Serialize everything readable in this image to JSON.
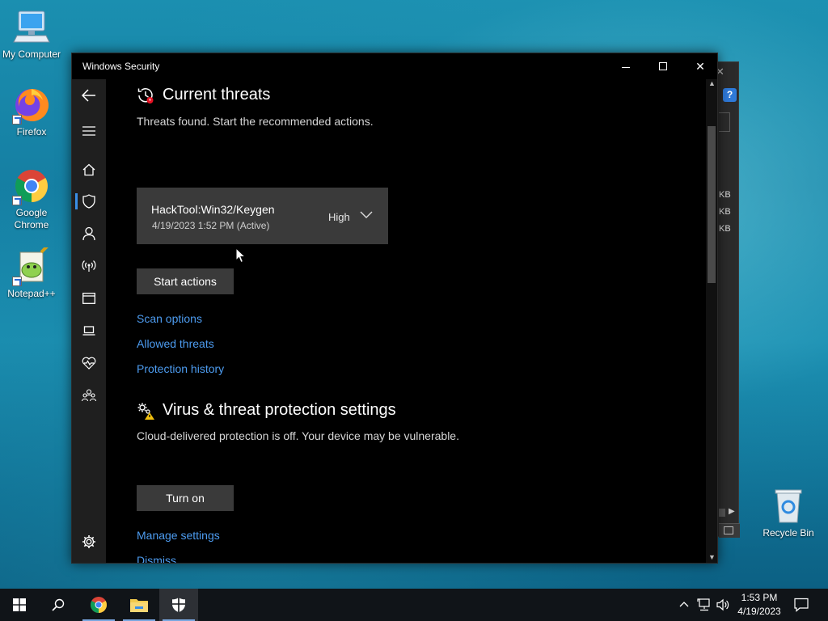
{
  "desktop": {
    "icons": [
      {
        "label": "My Computer"
      },
      {
        "label": "Firefox"
      },
      {
        "label": "Google Chrome"
      },
      {
        "label": "Notepad++"
      },
      {
        "label": "Recycle Bin"
      }
    ]
  },
  "back_window": {
    "close": "✕",
    "help": "?",
    "sizes": [
      "KB",
      "KB",
      "KB"
    ]
  },
  "window": {
    "title": "Windows Security",
    "controls": {
      "minimize": "",
      "maximize": "",
      "close": "✕"
    }
  },
  "nav": {
    "items": [
      {
        "name": "back",
        "icon": "back-arrow-icon"
      },
      {
        "name": "menu",
        "icon": "hamburger-icon"
      },
      {
        "name": "home",
        "icon": "home-icon"
      },
      {
        "name": "virus-protection",
        "icon": "shield-icon",
        "active": true
      },
      {
        "name": "account",
        "icon": "person-icon"
      },
      {
        "name": "firewall",
        "icon": "wireless-icon"
      },
      {
        "name": "app-browser",
        "icon": "browser-window-icon"
      },
      {
        "name": "device-security",
        "icon": "laptop-icon"
      },
      {
        "name": "device-health",
        "icon": "heart-icon"
      },
      {
        "name": "family",
        "icon": "family-icon"
      },
      {
        "name": "settings",
        "icon": "gear-icon"
      }
    ]
  },
  "current_threats": {
    "heading": "Current threats",
    "subtitle": "Threats found. Start the recommended actions.",
    "threat": {
      "name": "HackTool:Win32/Keygen",
      "date": "4/19/2023 1:52 PM (Active)",
      "severity": "High"
    },
    "start_button": "Start actions",
    "links": [
      "Scan options",
      "Allowed threats",
      "Protection history"
    ]
  },
  "protection_settings": {
    "heading": "Virus & threat protection settings",
    "subtitle": "Cloud-delivered protection is off. Your device may be vulnerable.",
    "turn_on_button": "Turn on",
    "links": [
      "Manage settings",
      "Dismiss"
    ]
  },
  "taskbar": {
    "time": "1:53 PM",
    "date": "4/19/2023",
    "apps": [
      "start",
      "search",
      "chrome",
      "file-explorer",
      "windows-security"
    ]
  },
  "colors": {
    "accent_link": "#4d9cf0",
    "active_nav": "#3a8ee6",
    "card_bg": "#3a3a3a"
  }
}
